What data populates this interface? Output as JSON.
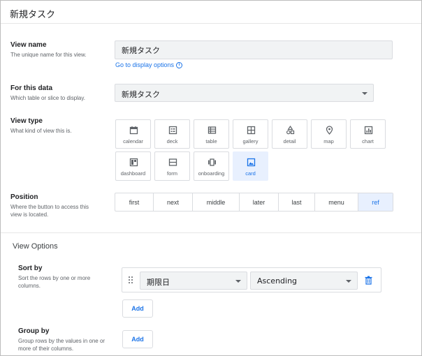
{
  "header": {
    "title": "新規タスク"
  },
  "view_name": {
    "label": "View name",
    "desc": "The unique name for this view.",
    "value": "新規タスク",
    "link": "Go to display options"
  },
  "for_this_data": {
    "label": "For this data",
    "desc": "Which table or slice to display.",
    "value": "新規タスク"
  },
  "view_type": {
    "label": "View type",
    "desc": "What kind of view this is.",
    "options": [
      "calendar",
      "deck",
      "table",
      "gallery",
      "detail",
      "map",
      "chart",
      "dashboard",
      "form",
      "onboarding",
      "card"
    ],
    "selected": "card"
  },
  "position": {
    "label": "Position",
    "desc": "Where the button to access this view is located.",
    "options": [
      "first",
      "next",
      "middle",
      "later",
      "last",
      "menu",
      "ref"
    ],
    "selected": "ref"
  },
  "view_options": {
    "title": "View Options",
    "sort_by": {
      "label": "Sort by",
      "desc": "Sort the rows by one or more columns.",
      "column": "期限日",
      "order": "Ascending",
      "add_label": "Add"
    },
    "group_by": {
      "label": "Group by",
      "desc": "Group rows by the values in one or more of their columns.",
      "add_label": "Add"
    }
  },
  "colors": {
    "accent": "#1a73e8",
    "selected_bg": "#e8f0fe",
    "field_bg": "#f1f3f4",
    "border": "#dadce0"
  }
}
